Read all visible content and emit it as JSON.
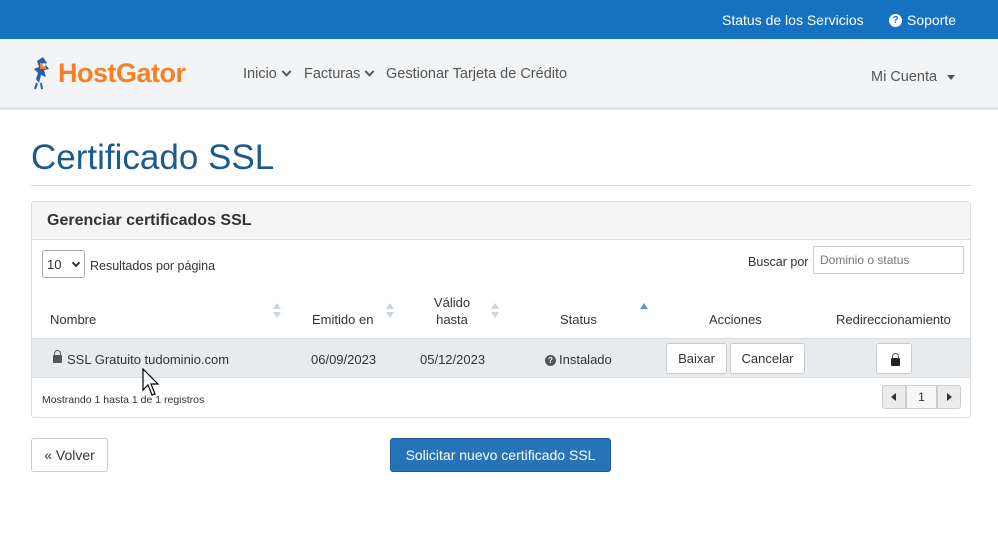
{
  "topbar": {
    "status_link": "Status de los Servicios",
    "support_link": "Soporte",
    "bg_color": "#1572c0"
  },
  "navbar": {
    "logo_text": "HostGator",
    "items": [
      {
        "label": "Inicio",
        "has_dropdown": true
      },
      {
        "label": "Facturas",
        "has_dropdown": true
      },
      {
        "label": "Gestionar Tarjeta de Crédito",
        "has_dropdown": false
      }
    ],
    "account_label": "Mi Cuenta"
  },
  "page": {
    "title": "Certificado SSL"
  },
  "panel": {
    "heading": "Gerenciar certificados SSL",
    "page_length": "10",
    "page_length_label": "Resultados por página",
    "search_label": "Buscar por",
    "search_placeholder": "Dominio o status",
    "columns": {
      "nombre": "Nombre",
      "emitido": "Emitido en",
      "valido_1": "Válido",
      "valido_2": "hasta",
      "status": "Status",
      "acciones": "Acciones",
      "redireccionamiento": "Redireccionamiento"
    },
    "rows": [
      {
        "nombre": "SSL Gratuito tudominio.com",
        "emitido": "06/09/2023",
        "valido": "05/12/2023",
        "status": "Instalado",
        "action_download": "Baixar",
        "action_cancel": "Cancelar"
      }
    ],
    "info": "Mostrando 1 hasta 1 de 1 registros",
    "current_page": "1"
  },
  "footer": {
    "back_label": "« Volver",
    "new_label": "Solicitar nuevo certificado SSL"
  },
  "colors": {
    "accent": "#2773b8",
    "title": "#1a5a8e",
    "logo": "#f58025"
  }
}
